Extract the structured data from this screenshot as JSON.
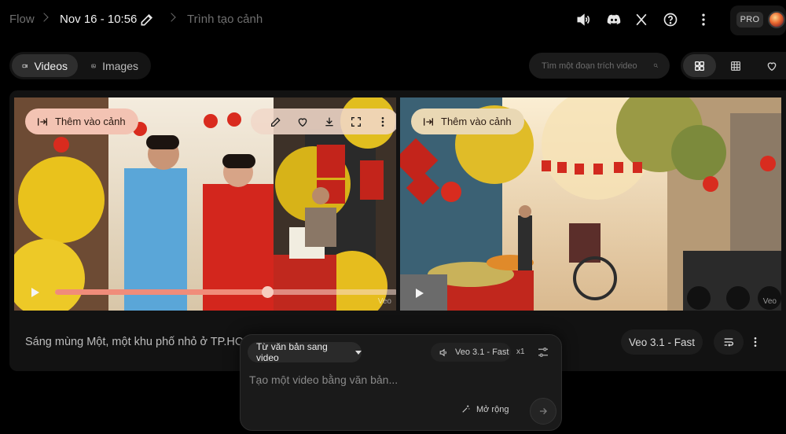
{
  "breadcrumb": {
    "root": "Flow",
    "project": "Nov 16 - 10:56",
    "page": "Trình tạo cảnh"
  },
  "header": {
    "icons": [
      "volume-icon",
      "discord-icon",
      "x-icon",
      "help-icon",
      "more-vert-icon"
    ],
    "plan_badge": "PRO"
  },
  "media_tabs": [
    {
      "label": "Videos",
      "icon": "video-icon",
      "active": true
    },
    {
      "label": "Images",
      "icon": "image-icon",
      "active": false
    }
  ],
  "search": {
    "placeholder": "Tìm một đoạn trích video"
  },
  "view_modes": [
    "grid-large-icon",
    "grid-small-icon",
    "favorite-icon"
  ],
  "clips": [
    {
      "add_label": "Thêm vào cảnh",
      "watermark": "Veo",
      "progress": 0.62
    },
    {
      "add_label": "Thêm vào cảnh",
      "watermark": "Veo"
    }
  ],
  "clip_tools": [
    "edit-icon",
    "favorite-icon",
    "download-icon",
    "fullscreen-icon",
    "more-vert-icon"
  ],
  "card": {
    "caption": "Sáng mùng Một, một khu phố nhỏ ở TP.HCM",
    "model": "Veo 3.1 - Fast"
  },
  "composer": {
    "mode": "Từ văn bản sang video",
    "model": "Veo 3.1 - Fast",
    "count": "x1",
    "placeholder": "Tạo một video bằng văn bản...",
    "expand_label": "Mở rộng"
  },
  "colors": {
    "background": "#000000",
    "panel": "#121212",
    "add_button_pink": "#f3c3b3",
    "add_button_beige": "#e9d8b4",
    "progress": "#f08c7a"
  }
}
